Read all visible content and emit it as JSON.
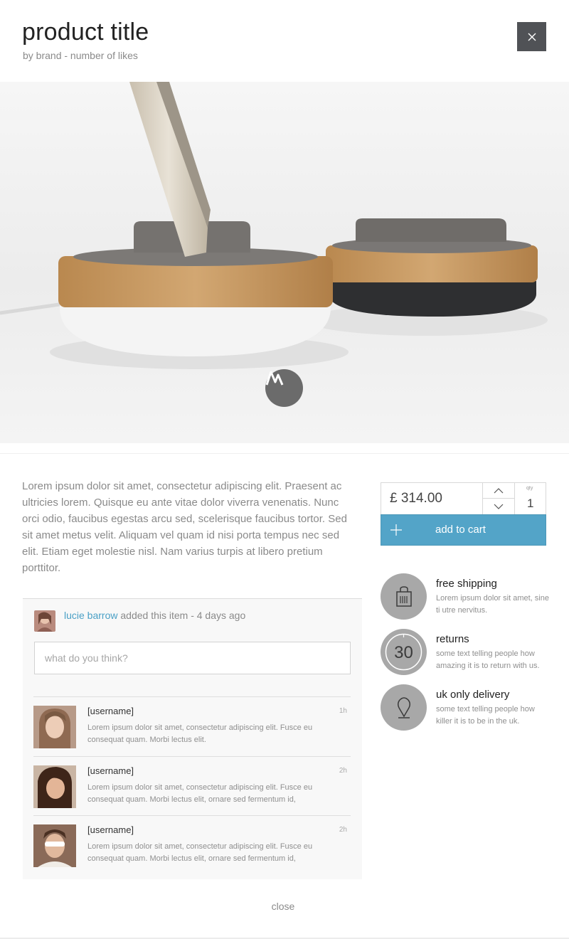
{
  "header": {
    "title": "product title",
    "subtitle": "by brand - number of likes"
  },
  "product": {
    "description": "Lorem ipsum dolor sit amet, consectetur adipiscing elit. Praesent ac ultricies lorem. Quisque eu ante vitae dolor viverra venenatis. Nunc orci odio, faucibus egestas arcu sed, scelerisque faucibus tortor. Sed sit amet metus velit. Aliquam vel quam id nisi porta tempus nec sed elit. Etiam eget molestie nisl. Nam varius turpis at libero pretium porttitor."
  },
  "purchase": {
    "price": "£ 314.00",
    "qty_label": "qty",
    "qty": "1",
    "add_to_cart": "add to cart",
    "accent_color": "#53a4c8"
  },
  "features": [
    {
      "title": "free shipping",
      "text": "Lorem ipsum dolor sit amet, sine ti utre nervitus.",
      "icon": "shopping-bag-icon"
    },
    {
      "title": "returns",
      "text": "some text telling people how amazing it is to return with us.",
      "icon": "30-days-icon",
      "badge": "30"
    },
    {
      "title": "uk only delivery",
      "text": "some text telling people how killer it is to be in the uk.",
      "icon": "map-pin-icon"
    }
  ],
  "activity": {
    "user": "lucie barrow",
    "text": " added this item - 4 days ago"
  },
  "comment_input": {
    "placeholder": "what do you think?"
  },
  "comments": [
    {
      "username": "[username]",
      "time": "1h",
      "text": "Lorem ipsum dolor sit amet, consectetur adipiscing elit. Fusce eu consequat quam. Morbi lectus elit."
    },
    {
      "username": "[username]",
      "time": "2h",
      "text": "Lorem ipsum dolor sit amet, consectetur adipiscing elit. Fusce eu consequat quam. Morbi lectus elit, ornare sed fermentum id,"
    },
    {
      "username": "[username]",
      "time": "2h",
      "text": "Lorem ipsum dolor sit amet, consectetur adipiscing elit. Fusce eu consequat quam. Morbi lectus elit, ornare sed fermentum id,"
    }
  ],
  "footer": {
    "close": "close"
  }
}
